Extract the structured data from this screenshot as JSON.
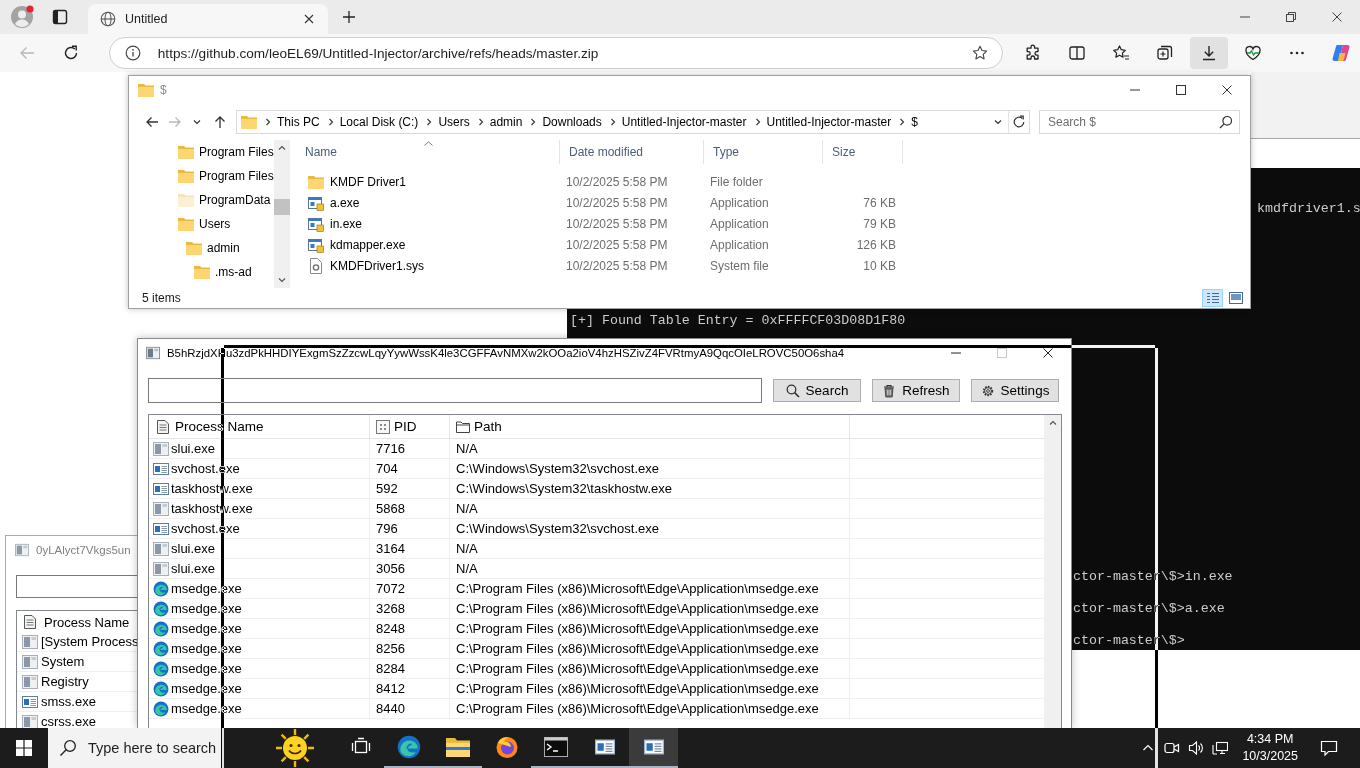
{
  "browser": {
    "nav": [
      {
        "kind": "back",
        "disabled": true
      },
      {
        "kind": "refresh",
        "disabled": false
      }
    ],
    "tab": {
      "title": "Untitled"
    },
    "address": {
      "url": "https://github.com/leoEL69/Untitled-Injector/archive/refs/heads/master.zip"
    },
    "toolbar": [
      {
        "kind": "extensions",
        "selected": false
      },
      {
        "kind": "split-screen",
        "selected": false
      },
      {
        "kind": "favorites",
        "selected": false
      },
      {
        "kind": "collections",
        "selected": false
      },
      {
        "kind": "downloads",
        "selected": true
      },
      {
        "kind": "essentials",
        "selected": false
      },
      {
        "kind": "more",
        "selected": false
      },
      {
        "kind": "copilot",
        "selected": false
      }
    ]
  },
  "explorer": {
    "title": "$",
    "active": false,
    "nav": [
      {
        "kind": "back",
        "disabled": false
      },
      {
        "kind": "forward",
        "disabled": true
      },
      {
        "kind": "recent",
        "disabled": false
      },
      {
        "kind": "up",
        "disabled": false
      }
    ],
    "breadcrumbs": [
      "This PC",
      "Local Disk (C:)",
      "Users",
      "admin",
      "Downloads",
      "Untitled-Injector-master",
      "Untitled-Injector-master",
      "$"
    ],
    "search": {
      "placeholder": "Search $"
    },
    "tree": [
      {
        "label": "Program Files",
        "hidden": false
      },
      {
        "label": "Program Files",
        "hidden": false
      },
      {
        "label": "ProgramData",
        "hidden": true
      },
      {
        "label": "Users",
        "hidden": false,
        "children": [
          {
            "label": "admin",
            "hidden": false,
            "children": [
              {
                "label": ".ms-ad",
                "hidden": false
              }
            ]
          }
        ]
      }
    ],
    "columns": [
      {
        "label": "Name",
        "sorted": true
      },
      {
        "label": "Date modified",
        "sorted": false
      },
      {
        "label": "Type",
        "sorted": false
      },
      {
        "label": "Size",
        "sorted": false
      }
    ],
    "files": [
      {
        "kind": "folder",
        "name": "KMDF Driver1",
        "date": "10/2/2025 5:58 PM",
        "type": "File folder"
      },
      {
        "kind": "application",
        "name": "a.exe",
        "date": "10/2/2025 5:58 PM",
        "type": "Application",
        "size": "76 KB"
      },
      {
        "kind": "application",
        "name": "in.exe",
        "date": "10/2/2025 5:58 PM",
        "type": "Application",
        "size": "79 KB"
      },
      {
        "kind": "application",
        "name": "kdmapper.exe",
        "date": "10/2/2025 5:58 PM",
        "type": "Application",
        "size": "126 KB"
      },
      {
        "kind": "system",
        "name": "KMDFDriver1.sys",
        "date": "10/2/2025 5:58 PM",
        "type": "System file",
        "size": "10 KB"
      }
    ],
    "status": "5 items",
    "views": [
      {
        "kind": "details",
        "selected": true
      },
      {
        "kind": "large-icons",
        "selected": false
      }
    ]
  },
  "console": {
    "lines": [
      "kmdfdriver1.s",
      "[+] Found Table Entry = 0xFFFFCF03D08D1F80",
      "ctor-master\\$>in.exe",
      "ctor-master\\$>a.exe",
      "ctor-master\\$>"
    ]
  },
  "process_window": {
    "title": "B5hRzjdXHu3zdPkHHDIYExgmSzZzcwLqyYywWssK4le3CGFFAvNMXw2kOOa2ioV4hzHSZivZ4FVRtmyA9QqcOIeLROVC50O6sha4",
    "active": true,
    "controls": [
      {
        "kind": "minimize",
        "disabled": false
      },
      {
        "kind": "maximize",
        "disabled": true
      },
      {
        "kind": "close",
        "disabled": false
      }
    ],
    "buttons": [
      {
        "kind": "search",
        "label": "Search"
      },
      {
        "kind": "refresh",
        "label": "Refresh"
      },
      {
        "kind": "settings",
        "label": "Settings"
      }
    ],
    "columns": [
      {
        "kind": "name",
        "label": "Process Name"
      },
      {
        "kind": "pid",
        "label": "PID"
      },
      {
        "kind": "path",
        "label": "Path"
      }
    ],
    "rows": [
      {
        "kind": "blank",
        "name": "slui.exe",
        "pid": "7716",
        "path": "N/A"
      },
      {
        "kind": "window",
        "name": "svchost.exe",
        "pid": "704",
        "path": "C:\\Windows\\System32\\svchost.exe"
      },
      {
        "kind": "window",
        "name": "taskhostw.exe",
        "pid": "592",
        "path": "C:\\Windows\\System32\\taskhostw.exe"
      },
      {
        "kind": "blank",
        "name": "taskhostw.exe",
        "pid": "5868",
        "path": "N/A"
      },
      {
        "kind": "window",
        "name": "svchost.exe",
        "pid": "796",
        "path": "C:\\Windows\\System32\\svchost.exe"
      },
      {
        "kind": "blank",
        "name": "slui.exe",
        "pid": "3164",
        "path": "N/A"
      },
      {
        "kind": "blank",
        "name": "slui.exe",
        "pid": "3056",
        "path": "N/A"
      },
      {
        "kind": "edge",
        "name": "msedge.exe",
        "pid": "7072",
        "path": "C:\\Program Files (x86)\\Microsoft\\Edge\\Application\\msedge.exe"
      },
      {
        "kind": "edge",
        "name": "msedge.exe",
        "pid": "3268",
        "path": "C:\\Program Files (x86)\\Microsoft\\Edge\\Application\\msedge.exe"
      },
      {
        "kind": "edge",
        "name": "msedge.exe",
        "pid": "8248",
        "path": "C:\\Program Files (x86)\\Microsoft\\Edge\\Application\\msedge.exe"
      },
      {
        "kind": "edge",
        "name": "msedge.exe",
        "pid": "8256",
        "path": "C:\\Program Files (x86)\\Microsoft\\Edge\\Application\\msedge.exe"
      },
      {
        "kind": "edge",
        "name": "msedge.exe",
        "pid": "8284",
        "path": "C:\\Program Files (x86)\\Microsoft\\Edge\\Application\\msedge.exe"
      },
      {
        "kind": "edge",
        "name": "msedge.exe",
        "pid": "8412",
        "path": "C:\\Program Files (x86)\\Microsoft\\Edge\\Application\\msedge.exe"
      },
      {
        "kind": "edge",
        "name": "msedge.exe",
        "pid": "8440",
        "path": "C:\\Program Files (x86)\\Microsoft\\Edge\\Application\\msedge.exe"
      }
    ]
  },
  "small_window": {
    "title": "0yLAlyct7Vkgs5un",
    "active": false,
    "column": "Process Name",
    "rows": [
      {
        "kind": "blank",
        "name": "[System Process"
      },
      {
        "kind": "blank",
        "name": "System"
      },
      {
        "kind": "blank",
        "name": "Registry"
      },
      {
        "kind": "window",
        "name": "smss.exe"
      },
      {
        "kind": "blank",
        "name": "csrss.exe"
      }
    ]
  },
  "taskbar": {
    "search": {
      "placeholder": "Type here to search"
    },
    "apps": [
      {
        "kind": "task-view",
        "running": false,
        "selected": false
      },
      {
        "kind": "edge",
        "running": true,
        "selected": false
      },
      {
        "kind": "explorer",
        "running": true,
        "selected": false
      },
      {
        "kind": "firefox",
        "running": false,
        "selected": false
      },
      {
        "kind": "terminal",
        "running": true,
        "selected": false
      },
      {
        "kind": "app-window",
        "running": true,
        "selected": false
      },
      {
        "kind": "app-window",
        "running": true,
        "selected": true
      }
    ],
    "clock": {
      "time": "4:34 PM",
      "date": "10/3/2025"
    }
  }
}
